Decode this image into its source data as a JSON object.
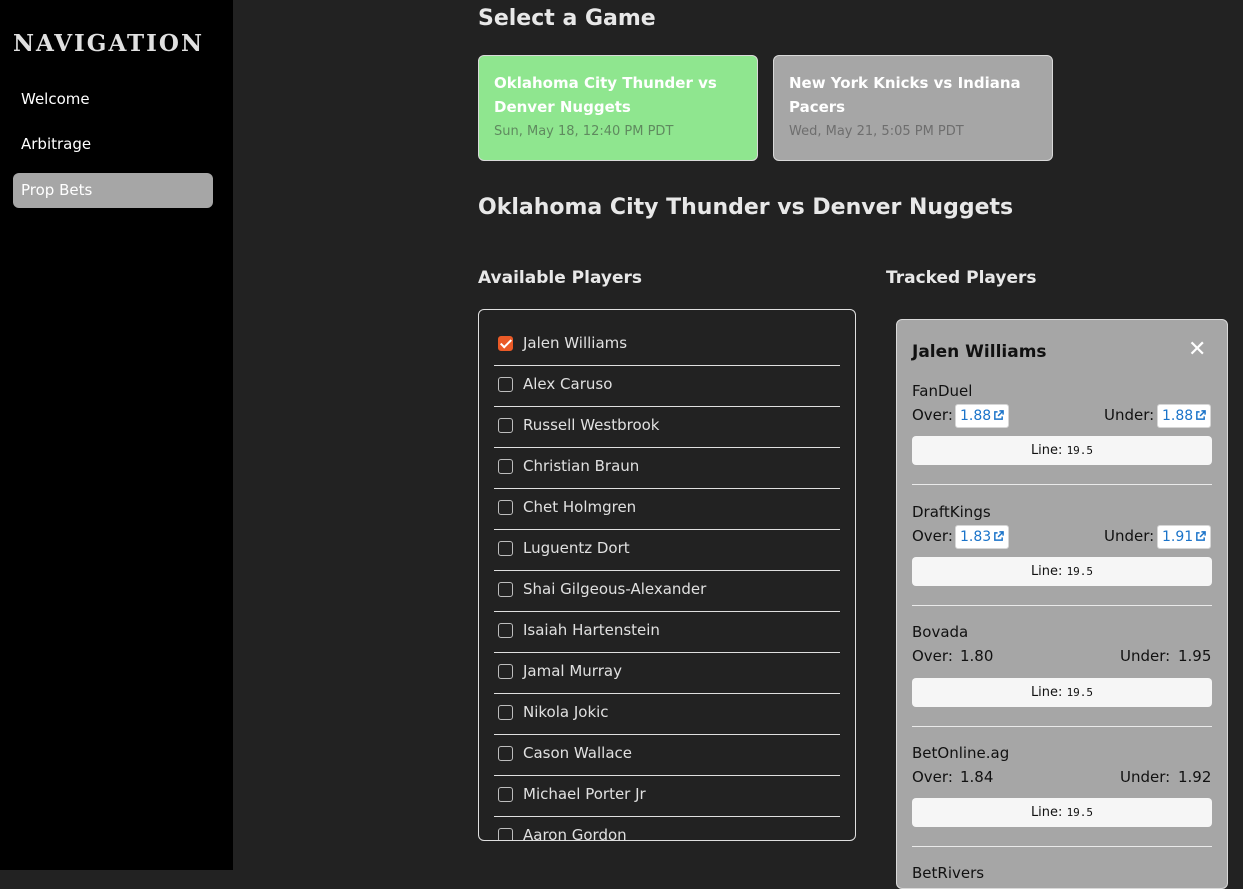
{
  "nav": {
    "title": "NAVIGATION",
    "items": [
      {
        "label": "Welcome"
      },
      {
        "label": "Arbitrage"
      },
      {
        "label": "Prop Bets"
      }
    ]
  },
  "select_game": {
    "heading": "Select a Game",
    "games": [
      {
        "title": "Oklahoma City Thunder vs Denver Nuggets",
        "date": "Sun, May 18, 12:40 PM PDT",
        "selected": true
      },
      {
        "title": "New York Knicks vs Indiana Pacers",
        "date": "Wed, May 21, 5:05 PM PDT",
        "selected": false
      }
    ]
  },
  "matchup_title": "Oklahoma City Thunder vs Denver Nuggets",
  "available": {
    "heading": "Available Players",
    "players": [
      {
        "name": "Jalen Williams",
        "checked": true
      },
      {
        "name": "Alex Caruso",
        "checked": false
      },
      {
        "name": "Russell Westbrook",
        "checked": false
      },
      {
        "name": "Christian Braun",
        "checked": false
      },
      {
        "name": "Chet Holmgren",
        "checked": false
      },
      {
        "name": "Luguentz Dort",
        "checked": false
      },
      {
        "name": "Shai Gilgeous-Alexander",
        "checked": false
      },
      {
        "name": "Isaiah Hartenstein",
        "checked": false
      },
      {
        "name": "Jamal Murray",
        "checked": false
      },
      {
        "name": "Nikola Jokic",
        "checked": false
      },
      {
        "name": "Cason Wallace",
        "checked": false
      },
      {
        "name": "Michael Porter Jr",
        "checked": false
      },
      {
        "name": "Aaron Gordon",
        "checked": false
      }
    ]
  },
  "tracked": {
    "heading": "Tracked Players",
    "player": {
      "name": "Jalen Williams",
      "close_icon": "close-icon",
      "over_label": "Over:",
      "under_label": "Under:",
      "line_label": "Line:",
      "books": [
        {
          "name": "FanDuel",
          "over": "1.88",
          "under": "1.88",
          "linked": true,
          "line": "19.5"
        },
        {
          "name": "DraftKings",
          "over": "1.83",
          "under": "1.91",
          "linked": true,
          "line": "19.5"
        },
        {
          "name": "Bovada",
          "over": "1.80",
          "under": "1.95",
          "linked": false,
          "line": "19.5"
        },
        {
          "name": "BetOnline.ag",
          "over": "1.84",
          "under": "1.92",
          "linked": false,
          "line": "19.5"
        },
        {
          "name": "BetRivers",
          "over": "",
          "under": "",
          "linked": false,
          "line": ""
        }
      ]
    }
  },
  "colors": {
    "selected_game": "#8fe68f",
    "unselected_game": "#a6a6a6",
    "checkbox_checked": "#ea5a27",
    "link": "#1a73c9"
  }
}
